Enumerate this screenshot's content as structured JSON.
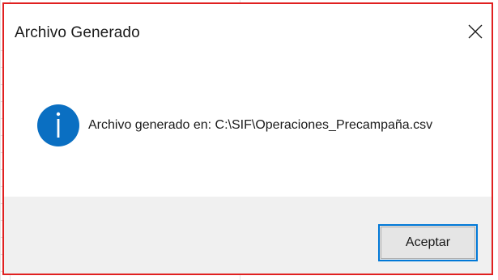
{
  "dialog": {
    "title": "Archivo Generado",
    "close_icon": "close-icon",
    "info_icon": "information-icon",
    "message": "Archivo generado en: C:\\SIF\\Operaciones_Precampaña.csv",
    "ok_label": "Aceptar"
  },
  "colors": {
    "highlight_border": "#e02020",
    "info_icon_fill": "#0a6fc2",
    "button_focus_border": "#0078d7",
    "footer_background": "#f0f0f0"
  }
}
